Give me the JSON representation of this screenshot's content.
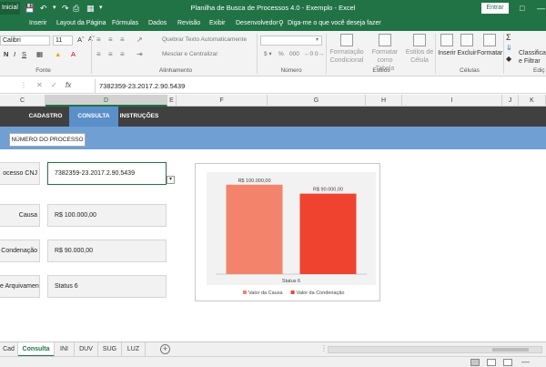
{
  "window": {
    "file_tab": "Inicial",
    "title": "Planilha de Busca de Processos 4.0 - Exemplo  -  Excel",
    "signin": "Entrar"
  },
  "ribbon_tabs": [
    "Inserir",
    "Layout da Página",
    "Fórmulas",
    "Dados",
    "Revisão",
    "Exibir",
    "Desenvolvedor"
  ],
  "tell_me": "Diga-me o que você deseja fazer",
  "ribbon": {
    "font_name": "Calibri",
    "font_size": "11",
    "wrap_text": "Quebrar Texto Automaticamente",
    "merge_center": "Mesclar e Centralizar",
    "cond_format_1": "Formatação",
    "cond_format_2": "Condicional",
    "format_table_1": "Formatar como",
    "format_table_2": "Tabela",
    "cell_styles_1": "Estilos de",
    "cell_styles_2": "Célula",
    "insert": "Inserir",
    "delete": "Excluir",
    "format": "Formatar",
    "sort_1": "Classifica",
    "sort_2": "e Filtrar",
    "group_font": "Fonte",
    "group_alignment": "Alinhamento",
    "group_number": "Número",
    "group_styles": "Estilos",
    "group_cells": "Células",
    "group_edit": "Ediç"
  },
  "formula_bar": {
    "value": "7382359-23.2017.2.90.5439"
  },
  "columns": [
    "C",
    "D",
    "E",
    "F",
    "G",
    "H",
    "I",
    "J",
    "K"
  ],
  "selected_column": "D",
  "nav": {
    "items": [
      "CADASTRO",
      "CONSULTA",
      "INSTRUÇÕES"
    ],
    "active": "CONSULTA",
    "subtab": "NÚMERO DO PROCESSO"
  },
  "form": {
    "rows": [
      {
        "label": "ocesso CNJ",
        "value": "7382359-23.2017.2.90.5439"
      },
      {
        "label": "Causa",
        "value": "R$ 100.000,00"
      },
      {
        "label": "Condenação",
        "value": "R$ 90.000,00"
      },
      {
        "label": "e Arquivamento",
        "value": "Status 6"
      }
    ]
  },
  "chart_data": {
    "type": "bar",
    "categories": [
      "Status 6"
    ],
    "series": [
      {
        "name": "Valor da Causa",
        "values": [
          100000
        ],
        "color": "#f4836b",
        "label": "R$ 100.000,00"
      },
      {
        "name": "Valor da Condenação",
        "values": [
          90000
        ],
        "color": "#ef4330",
        "label": "R$ 90.000,00"
      }
    ],
    "ylim": [
      0,
      110000
    ],
    "grid": false,
    "legend": "bottom",
    "title": ""
  },
  "sheet_tabs": [
    "Cad",
    "Consulta",
    "INI",
    "DUV",
    "SUG",
    "LUZ"
  ],
  "active_sheet": "Consulta",
  "icons": {
    "save": "save-icon",
    "undo": "undo-icon",
    "redo": "redo-icon",
    "add_sheet": "plus-circle-icon"
  }
}
